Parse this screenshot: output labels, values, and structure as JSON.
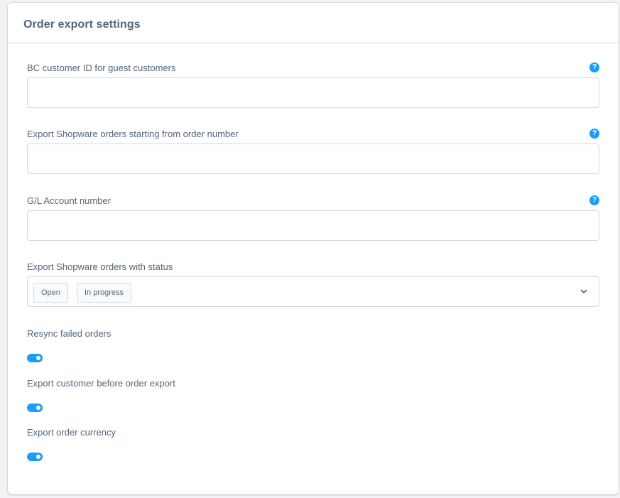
{
  "card": {
    "title": "Order export settings"
  },
  "fields": {
    "guest_customer_id": {
      "label": "BC customer ID for guest customers",
      "value": ""
    },
    "start_order_number": {
      "label": "Export Shopware orders starting from order number",
      "value": ""
    },
    "gl_account": {
      "label": "G/L Account number",
      "value": ""
    },
    "order_status": {
      "label": "Export Shopware orders with status",
      "selected": [
        "Open",
        "In progress"
      ]
    }
  },
  "toggles": {
    "resync_failed": {
      "label": "Resync failed orders",
      "enabled": true
    },
    "export_customer": {
      "label": "Export customer before order export",
      "enabled": true
    },
    "export_currency": {
      "label": "Export order currency",
      "enabled": true
    }
  },
  "help_glyph": "?",
  "colors": {
    "accent": "#189eff",
    "text": "#52667a",
    "border": "#d1d9e0"
  }
}
